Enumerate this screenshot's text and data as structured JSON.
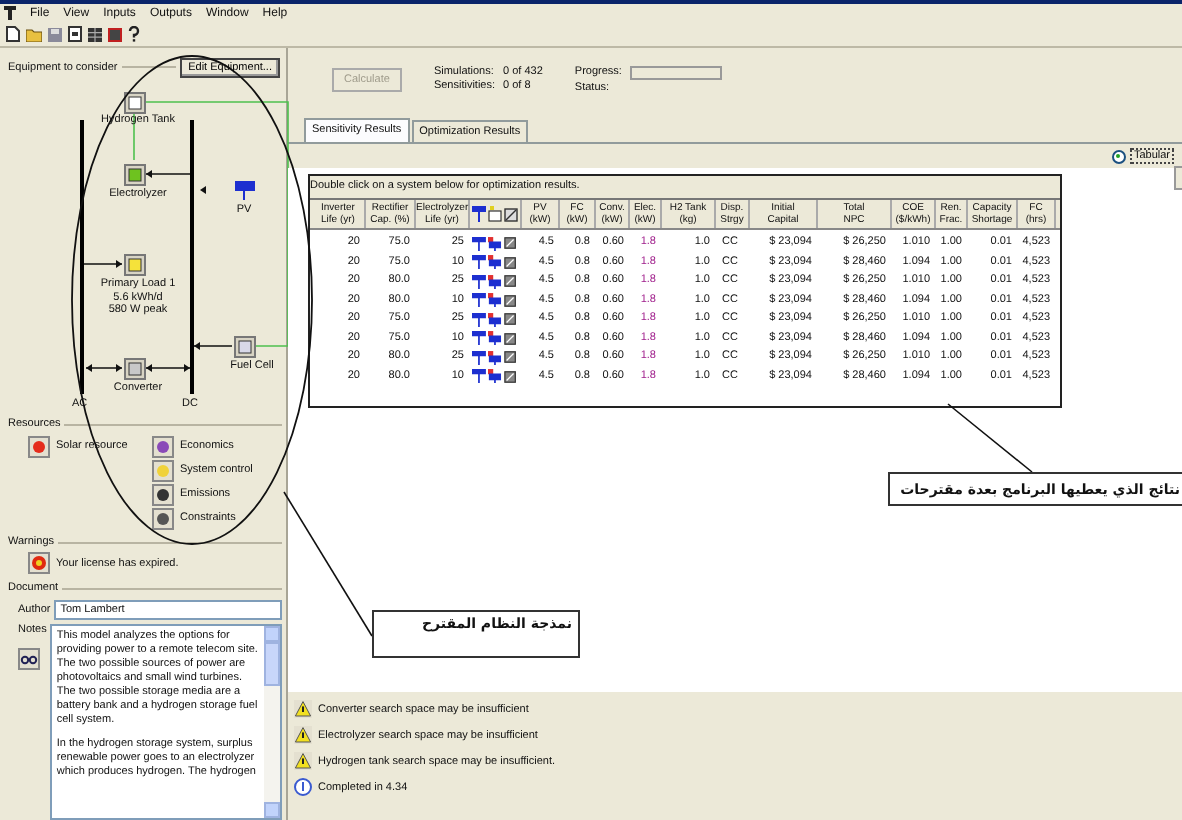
{
  "menu": [
    "File",
    "View",
    "Inputs",
    "Outputs",
    "Window",
    "Help"
  ],
  "equipment": {
    "title": "Equipment to consider",
    "edit_button": "Edit Equipment...",
    "components": [
      {
        "kind": "tank",
        "label": "Hydrogen Tank"
      },
      {
        "kind": "electrolyzer",
        "label": "Electrolyzer"
      },
      {
        "kind": "pv",
        "label": "PV"
      },
      {
        "kind": "load",
        "label": "Primary Load 1\n5.6 kWh/d\n580 W peak"
      },
      {
        "kind": "fuelcell",
        "label": "Fuel Cell"
      },
      {
        "kind": "converter",
        "label": "Converter"
      }
    ],
    "buses": [
      "AC",
      "DC"
    ]
  },
  "resources": {
    "title": "Resources",
    "items": [
      {
        "kind": "solar",
        "label": "Solar resource"
      },
      {
        "kind": "economics",
        "label": "Economics"
      },
      {
        "kind": "control",
        "label": "System control"
      },
      {
        "kind": "emissions",
        "label": "Emissions"
      },
      {
        "kind": "constraints",
        "label": "Constraints"
      }
    ]
  },
  "warnings": {
    "title": "Warnings",
    "text": "Your license has expired."
  },
  "document": {
    "title": "Document",
    "author_label": "Author",
    "author": "Tom Lambert",
    "notes_label": "Notes",
    "notes": [
      "This model analyzes the options for providing power to a remote telecom site. The two possible sources of power are photovoltaics and small wind turbines. The two possible storage media are a battery bank and a hydrogen storage fuel cell system.",
      "In the hydrogen storage system, surplus renewable power goes to an electrolyzer which produces hydrogen. The hydrogen"
    ]
  },
  "run": {
    "calculate": {
      "label": "Calculate",
      "disabled": true
    },
    "simulations_label": "Simulations:",
    "simulations": "0 of 432",
    "sensitivities_label": "Sensitivities:",
    "sensitivities": "0 of 8",
    "progress_label": "Progress:",
    "status_label": "Status:"
  },
  "tabs": [
    {
      "label": "Sensitivity Results",
      "selected": true
    },
    {
      "label": "Optimization Results",
      "selected": false
    }
  ],
  "view_options": [
    {
      "label": "Tabular",
      "selected": true
    }
  ],
  "table": {
    "caption": "Double click on a system below for optimization results.",
    "columns": [
      {
        "kind": "text",
        "label": "Inverter\nLife (yr)"
      },
      {
        "kind": "text",
        "label": "Rectifier\nCap. (%)"
      },
      {
        "kind": "text",
        "label": "Electrolyzer\nLife (yr)"
      },
      {
        "kind": "icons"
      },
      {
        "kind": "text",
        "label": "PV\n(kW)"
      },
      {
        "kind": "text",
        "label": "FC\n(kW)"
      },
      {
        "kind": "text",
        "label": "Conv.\n(kW)"
      },
      {
        "kind": "text",
        "label": "Elec.\n(kW)"
      },
      {
        "kind": "text",
        "label": "H2 Tank\n(kg)"
      },
      {
        "kind": "text",
        "label": "Disp.\nStrgy"
      },
      {
        "kind": "text",
        "label": "Initial\nCapital"
      },
      {
        "kind": "text",
        "label": "Total\nNPC"
      },
      {
        "kind": "text",
        "label": "COE\n($/kWh)"
      },
      {
        "kind": "text",
        "label": "Ren.\nFrac."
      },
      {
        "kind": "text",
        "label": "Capacity\nShortage"
      },
      {
        "kind": "text",
        "label": "FC\n(hrs)"
      }
    ],
    "rows": [
      [
        "20",
        "75.0",
        "25",
        "",
        "4.5",
        "0.8",
        "0.60",
        "1.8",
        "1.0",
        "CC",
        "$ 23,094",
        "$ 26,250",
        "1.010",
        "1.00",
        "0.01",
        "4,523"
      ],
      [
        "20",
        "75.0",
        "10",
        "",
        "4.5",
        "0.8",
        "0.60",
        "1.8",
        "1.0",
        "CC",
        "$ 23,094",
        "$ 28,460",
        "1.094",
        "1.00",
        "0.01",
        "4,523"
      ],
      [
        "20",
        "80.0",
        "25",
        "",
        "4.5",
        "0.8",
        "0.60",
        "1.8",
        "1.0",
        "CC",
        "$ 23,094",
        "$ 26,250",
        "1.010",
        "1.00",
        "0.01",
        "4,523"
      ],
      [
        "20",
        "80.0",
        "10",
        "",
        "4.5",
        "0.8",
        "0.60",
        "1.8",
        "1.0",
        "CC",
        "$ 23,094",
        "$ 28,460",
        "1.094",
        "1.00",
        "0.01",
        "4,523"
      ],
      [
        "20",
        "75.0",
        "25",
        "",
        "4.5",
        "0.8",
        "0.60",
        "1.8",
        "1.0",
        "CC",
        "$ 23,094",
        "$ 26,250",
        "1.010",
        "1.00",
        "0.01",
        "4,523"
      ],
      [
        "20",
        "75.0",
        "10",
        "",
        "4.5",
        "0.8",
        "0.60",
        "1.8",
        "1.0",
        "CC",
        "$ 23,094",
        "$ 28,460",
        "1.094",
        "1.00",
        "0.01",
        "4,523"
      ],
      [
        "20",
        "80.0",
        "25",
        "",
        "4.5",
        "0.8",
        "0.60",
        "1.8",
        "1.0",
        "CC",
        "$ 23,094",
        "$ 26,250",
        "1.010",
        "1.00",
        "0.01",
        "4,523"
      ],
      [
        "20",
        "80.0",
        "10",
        "",
        "4.5",
        "0.8",
        "0.60",
        "1.8",
        "1.0",
        "CC",
        "$ 23,094",
        "$ 28,460",
        "1.094",
        "1.00",
        "0.01",
        "4,523"
      ]
    ]
  },
  "messages": [
    {
      "kind": "warning",
      "text": "Converter search space may be insufficient"
    },
    {
      "kind": "warning",
      "text": "Electrolyzer search space may be insufficient"
    },
    {
      "kind": "warning",
      "text": "Hydrogen tank search space may be insufficient."
    },
    {
      "kind": "info",
      "text": "Completed in 4.34"
    }
  ],
  "annotations": [
    {
      "kind": "results",
      "text": "نتائج الذي يعطيها البرنامج بعدة مقترحات"
    },
    {
      "kind": "model",
      "text": "نمذجة النظام المقترح"
    }
  ]
}
